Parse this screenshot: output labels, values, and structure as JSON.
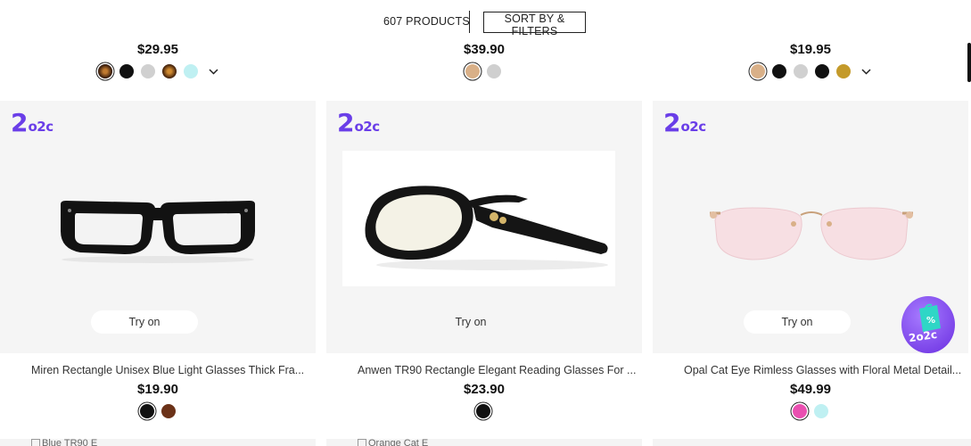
{
  "toolbar": {
    "product_count": "607 PRODUCTS",
    "sort_filters_label": "SORT BY & FILTERS"
  },
  "top_row": [
    {
      "price": "$29.95",
      "colors": [
        "#3a1a0a",
        "#111111",
        "#d0d0d0",
        "#5a2a10",
        "#bff0f2"
      ],
      "selected": 0,
      "more_icon": "chevron-down-icon"
    },
    {
      "price": "$39.90",
      "colors": [
        "#d9b088",
        "#cfcfcf"
      ],
      "selected": 0,
      "more_icon": null
    },
    {
      "price": "$19.95",
      "colors": [
        "#d9b088",
        "#111111",
        "#d0d0d0",
        "#111111",
        "#c49a2a"
      ],
      "selected": 0,
      "more_icon": "chevron-down-icon"
    }
  ],
  "products": [
    {
      "name": "Miren Rectangle Unisex Blue Light Glasses Thick Fra...",
      "price": "$19.90",
      "colors": [
        "#111111",
        "#6b3218"
      ],
      "selected": 0,
      "try_on": "Try on",
      "logo": {
        "big": "2",
        "small": "o2c"
      }
    },
    {
      "name": "Anwen TR90 Rectangle Elegant Reading Glasses For ...",
      "price": "$23.90",
      "colors": [
        "#111111"
      ],
      "selected": 0,
      "try_on": "Try on",
      "logo": {
        "big": "2",
        "small": "o2c"
      }
    },
    {
      "name": "Opal Cat Eye Rimless Glasses with Floral Metal Detail...",
      "price": "$49.99",
      "colors": [
        "#e94fb0",
        "#bff0f2"
      ],
      "selected": 0,
      "try_on": "Try on",
      "logo": {
        "big": "2",
        "small": "o2c"
      }
    }
  ],
  "next_row": [
    {
      "alt_text": "Blue TR90 E"
    },
    {
      "alt_text": "Orange Cat E"
    }
  ],
  "promo": {
    "label": "2o2c",
    "icon": "shopping-bag-percent-icon"
  },
  "colors": {
    "brand": "#6a3ee8",
    "card_bg": "#f5f5f5"
  }
}
